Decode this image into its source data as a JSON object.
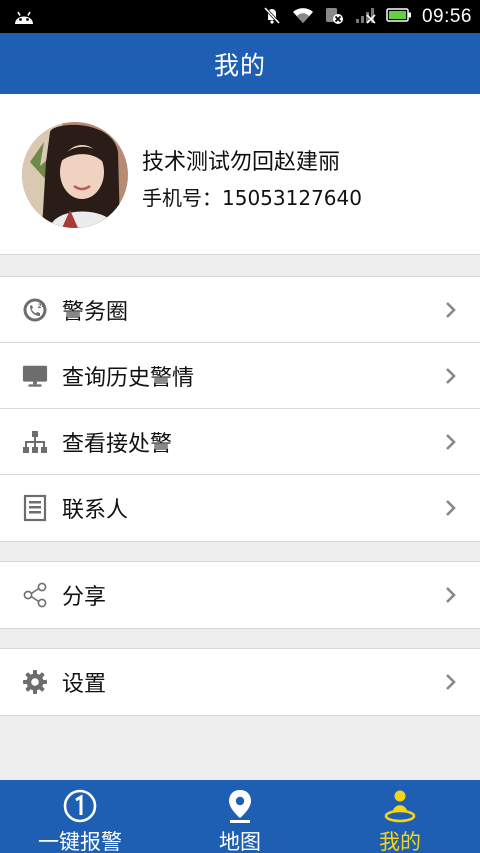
{
  "status_bar": {
    "time": "09:56",
    "icons": [
      "android-icon",
      "mute-icon",
      "wifi-icon",
      "sim-icon",
      "signal-icon",
      "battery-icon"
    ]
  },
  "header": {
    "title": "我的"
  },
  "profile": {
    "name": "技术测试勿回赵建丽",
    "phone": "手机号：15053127640"
  },
  "menu_groups": [
    {
      "items": [
        {
          "label": "警务圈",
          "icon": "police-circle-icon"
        },
        {
          "label": "查询历史警情",
          "icon": "monitor-icon"
        },
        {
          "label": "查看接处警",
          "icon": "org-chart-icon"
        },
        {
          "label": "联系人",
          "icon": "contacts-icon"
        }
      ]
    },
    {
      "items": [
        {
          "label": "分享",
          "icon": "share-icon"
        }
      ]
    },
    {
      "items": [
        {
          "label": "设置",
          "icon": "gear-icon"
        }
      ]
    }
  ],
  "tabs": [
    {
      "label": "一键报警",
      "icon": "alarm-icon",
      "active": false
    },
    {
      "label": "地图",
      "icon": "map-pin-icon",
      "active": false
    },
    {
      "label": "我的",
      "icon": "person-icon",
      "active": true
    }
  ],
  "colors": {
    "primary": "#1e5fb3",
    "active_tab": "#f6d416",
    "background": "#eeeeee"
  }
}
